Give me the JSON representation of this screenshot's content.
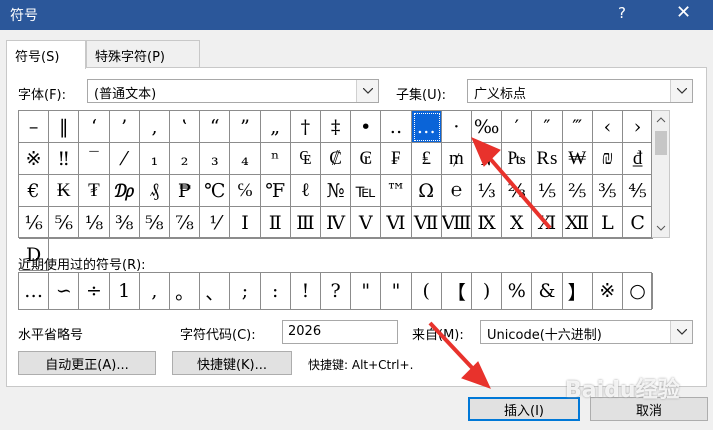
{
  "window": {
    "title": "符号",
    "help": "?",
    "close": "✕"
  },
  "tabs": [
    {
      "label": "符号(S)"
    },
    {
      "label": "特殊字符(P)"
    }
  ],
  "font": {
    "label": "字体(F):",
    "value": "(普通文本)"
  },
  "subset": {
    "label": "子集(U):",
    "value": "广义标点"
  },
  "symbols": [
    "–",
    "‖",
    "‘",
    "’",
    "‚",
    "‛",
    "“",
    "”",
    "„",
    "†",
    "‡",
    "•",
    "‥",
    "…",
    "·",
    "‰",
    "′",
    "″",
    "‴",
    "‹",
    "›",
    "※",
    "‼",
    "‾",
    "⁄",
    "₁",
    "₂",
    "₃",
    "₄",
    "ⁿ",
    "₠",
    "₡",
    "₢",
    "₣",
    "₤",
    "₥",
    "₦",
    "₧",
    "₨",
    "₩",
    "₪",
    "₫",
    "€",
    "₭",
    "₮",
    "₯",
    "₰",
    "₱",
    "℃",
    "℅",
    "℉",
    "ℓ",
    "№",
    "℡",
    "™",
    "Ω",
    "℮",
    "⅓",
    "⅔",
    "⅕",
    "⅖",
    "⅗",
    "⅘",
    "⅙",
    "⅚",
    "⅛",
    "⅜",
    "⅝",
    "⅞",
    "⅟",
    "Ⅰ",
    "Ⅱ",
    "Ⅲ",
    "Ⅳ",
    "Ⅴ",
    "Ⅵ",
    "Ⅶ",
    "Ⅷ",
    "Ⅸ",
    "Ⅹ",
    "Ⅺ",
    "Ⅻ",
    "Ⅼ",
    "Ⅽ",
    "Ⅾ"
  ],
  "recent_label": "近期使用过的符号(R):",
  "recent": [
    "…",
    "∽",
    "÷",
    "1",
    ",",
    "。",
    "、",
    ";",
    ":",
    "!",
    "?",
    "\"",
    "\"",
    "(",
    "【",
    ")",
    "%",
    "&",
    "】",
    "※",
    "○"
  ],
  "char_name": "水平省略号",
  "char_code": {
    "label": "字符代码(C):",
    "value": "2026"
  },
  "from": {
    "label": "来自(M):",
    "value": "Unicode(十六进制)"
  },
  "autocorrect_button": "自动更正(A)...",
  "shortcut_button": "快捷键(K)...",
  "shortcut_text": "快捷键: Alt+Ctrl+.",
  "insert_button": "插入(I)",
  "cancel_button": "取消",
  "watermark": "Baidu经验",
  "accent_color": "#0a64d8",
  "arrow_color": "#e8322c"
}
